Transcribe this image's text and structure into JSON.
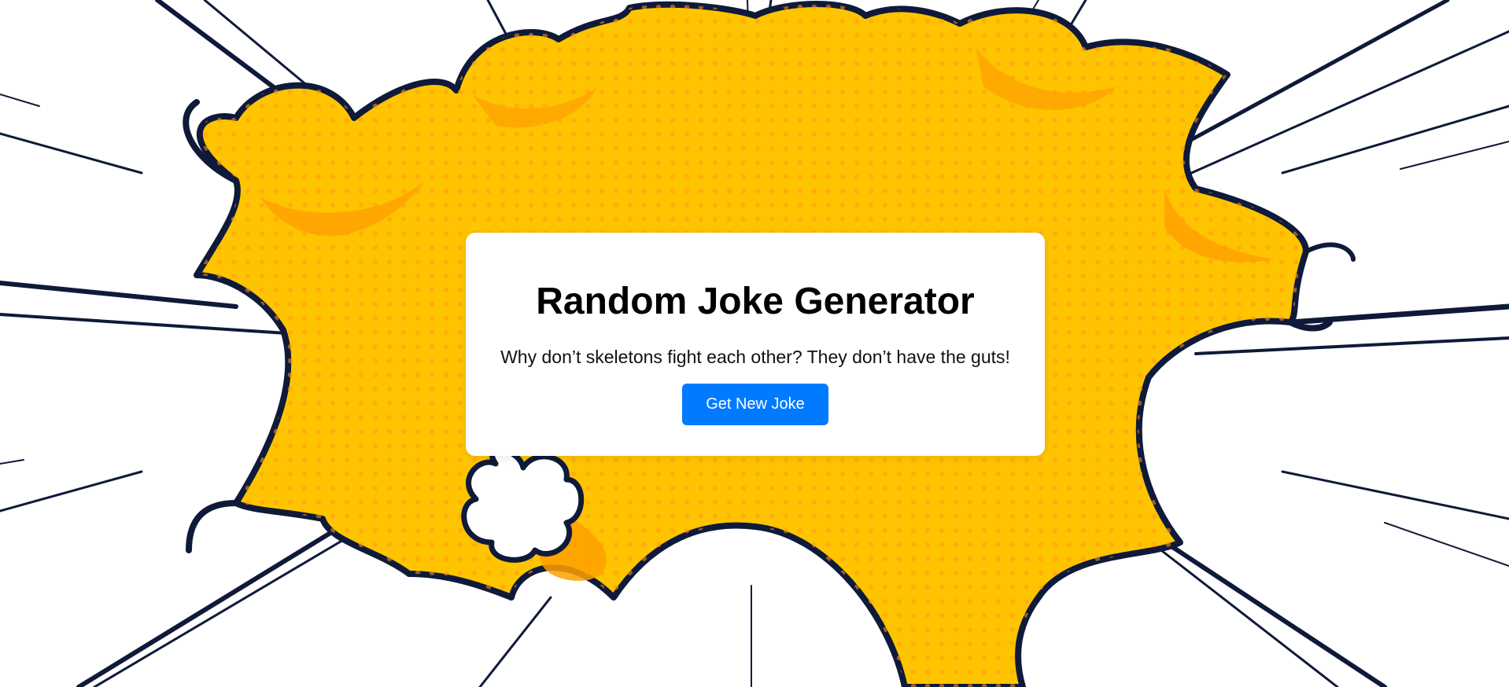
{
  "app": {
    "title": "Random Joke Generator",
    "joke_text": "Why don’t skeletons fight each other? They don’t have the guts!",
    "button_label": "Get New Joke"
  },
  "colors": {
    "burst_fill": "#ffc400",
    "burst_shade": "#ffa000",
    "outline": "#0f1a3a",
    "button": "#007bff",
    "card": "#ffffff"
  },
  "background": {
    "style": "comic-explosion-burst",
    "icon": "explosion-burst-illustration"
  }
}
